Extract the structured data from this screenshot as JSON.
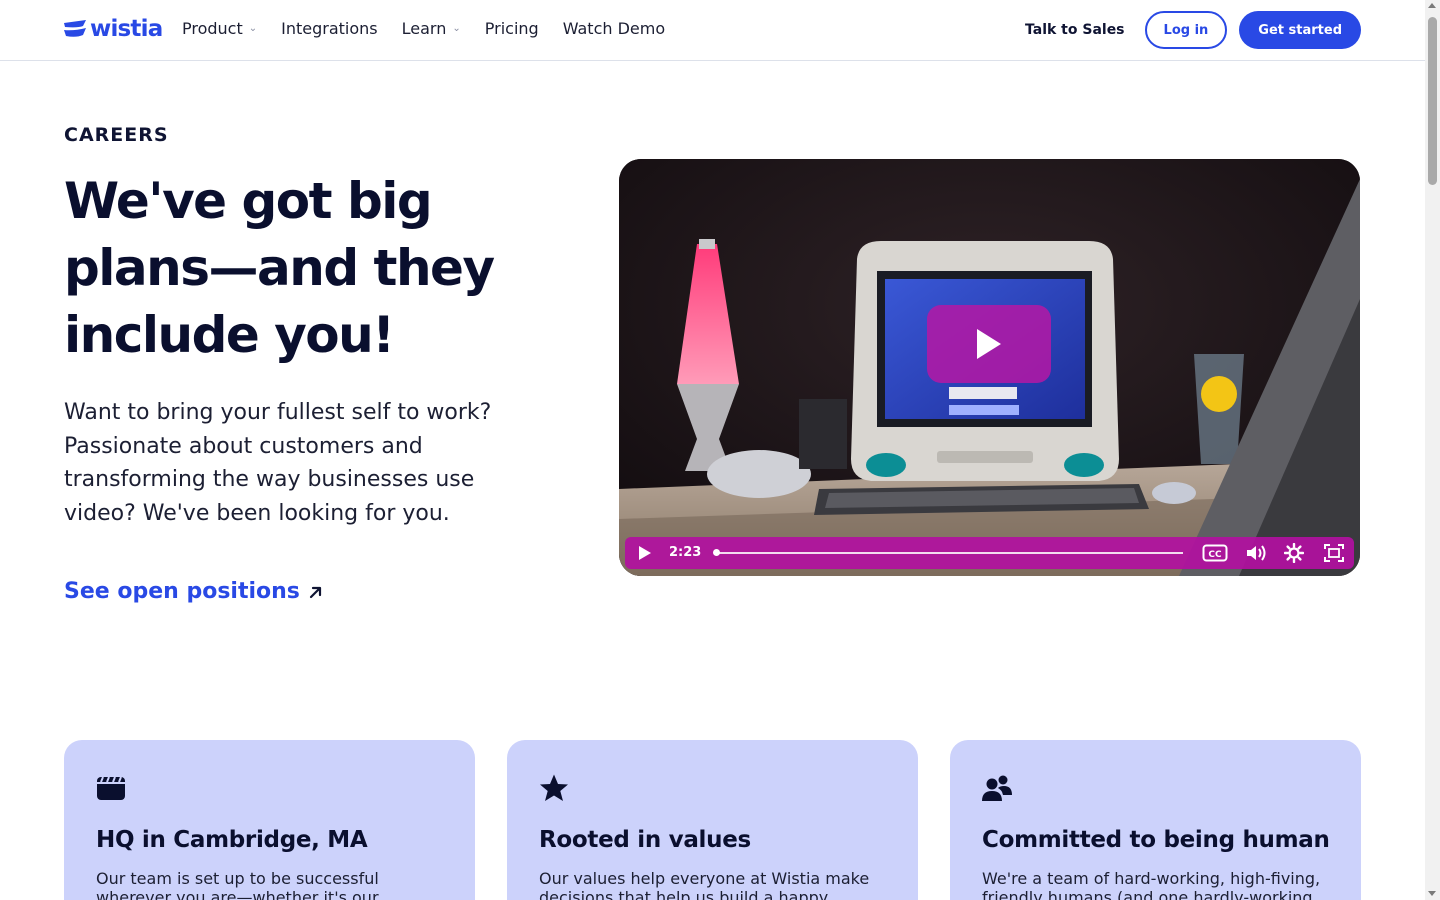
{
  "brand": {
    "name": "wistia",
    "accent": "#2949e5",
    "card_bg": "#ccd2fb",
    "video_brand": "#b510a0"
  },
  "nav": {
    "items": [
      {
        "label": "Product",
        "has_dropdown": true
      },
      {
        "label": "Integrations",
        "has_dropdown": false
      },
      {
        "label": "Learn",
        "has_dropdown": true
      },
      {
        "label": "Pricing",
        "has_dropdown": false
      },
      {
        "label": "Watch Demo",
        "has_dropdown": false
      }
    ],
    "talk_to_sales": "Talk to Sales",
    "login": "Log in",
    "get_started": "Get started"
  },
  "hero": {
    "eyebrow": "CAREERS",
    "headline_line1": "We've got big",
    "headline_line2": "plans—and they",
    "headline_line3": "include you!",
    "lead": "Want to bring your fullest self to work? Passionate about customers and transforming the way businesses use video? We've been looking for you.",
    "cta": "See open positions"
  },
  "video": {
    "time": "2:23",
    "progress": 0.0,
    "controls": [
      "play-icon",
      "captions-icon",
      "volume-icon",
      "settings-icon",
      "fullscreen-icon"
    ]
  },
  "cards": [
    {
      "icon": "clapperboard-icon",
      "title": "HQ in Cambridge, MA",
      "body": "Our team is set up to be successful wherever you are—whether it's our headquarters in"
    },
    {
      "icon": "star-icon",
      "title": "Rooted in values",
      "body": "Our values help everyone at Wistia make decisions that help us build a happy, lasting"
    },
    {
      "icon": "people-icon",
      "title": "Committed to being human",
      "body": "We're a team of hard-working, high-fiving, friendly humans (and one hardly-working"
    }
  ]
}
